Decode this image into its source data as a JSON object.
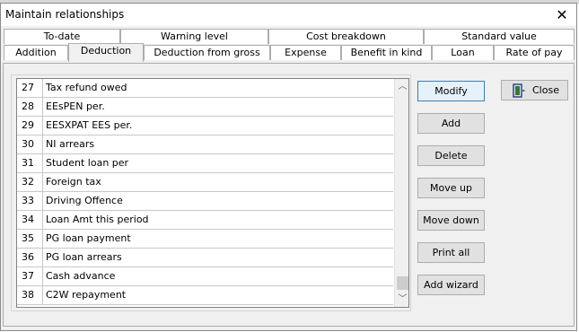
{
  "window": {
    "title": "Maintain relationships",
    "close_glyph": "✕"
  },
  "tabs_top": [
    {
      "label": "To-date"
    },
    {
      "label": "Warning level"
    },
    {
      "label": "Cost breakdown"
    },
    {
      "label": "Standard value"
    }
  ],
  "tabs_bottom": [
    {
      "label": "Addition"
    },
    {
      "label": "Deduction",
      "active": true
    },
    {
      "label": "Deduction from gross"
    },
    {
      "label": "Expense"
    },
    {
      "label": "Benefit in kind"
    },
    {
      "label": "Loan"
    },
    {
      "label": "Rate of pay"
    }
  ],
  "list": {
    "rows": [
      {
        "num": "27",
        "desc": "Tax refund owed"
      },
      {
        "num": "28",
        "desc": "EEsPEN per."
      },
      {
        "num": "29",
        "desc": "EESXPAT EES per."
      },
      {
        "num": "30",
        "desc": "NI arrears"
      },
      {
        "num": "31",
        "desc": "Student loan per"
      },
      {
        "num": "32",
        "desc": "Foreign tax"
      },
      {
        "num": "33",
        "desc": "Driving Offence"
      },
      {
        "num": "34",
        "desc": "Loan Amt this period"
      },
      {
        "num": "35",
        "desc": "PG loan payment"
      },
      {
        "num": "36",
        "desc": "PG loan arrears"
      },
      {
        "num": "37",
        "desc": "Cash advance"
      },
      {
        "num": "38",
        "desc": "C2W repayment"
      }
    ],
    "scroll_up_glyph": "︿",
    "scroll_down_glyph": "﹀"
  },
  "buttons": {
    "modify": "Modify",
    "add": "Add",
    "delete": "Delete",
    "move_up": "Move up",
    "move_down": "Move down",
    "print_all": "Print all",
    "add_wizard": "Add wizard",
    "close": "Close"
  },
  "colors": {
    "door_icon": "#2e7d32",
    "door_frame": "#1f3a93"
  }
}
